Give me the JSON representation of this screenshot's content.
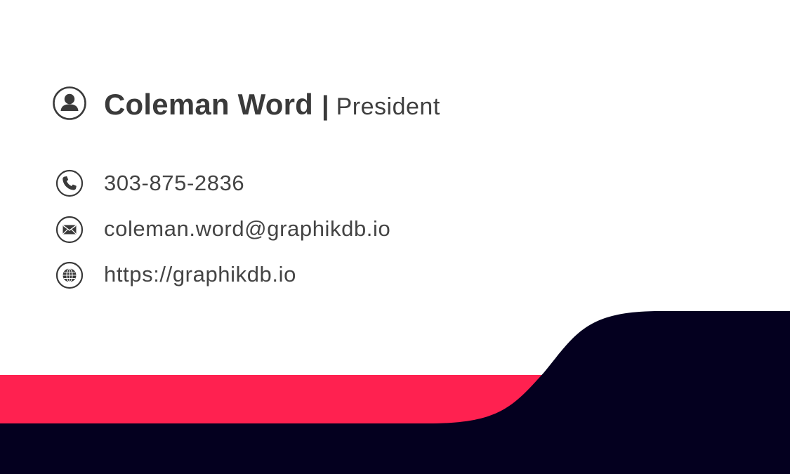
{
  "card": {
    "name": "Coleman Word",
    "separator": "|",
    "title": "President",
    "phone": "303-875-2836",
    "email": "coleman.word@graphikdb.io",
    "website": "https://graphikdb.io"
  },
  "icons": {
    "person": "person-icon",
    "phone": "phone-icon",
    "email": "envelope-icon",
    "website": "globe-icon"
  },
  "colors": {
    "accent": "#ff2150",
    "dark": "#04001f",
    "text": "#3f3f3f",
    "background": "#ffffff"
  }
}
